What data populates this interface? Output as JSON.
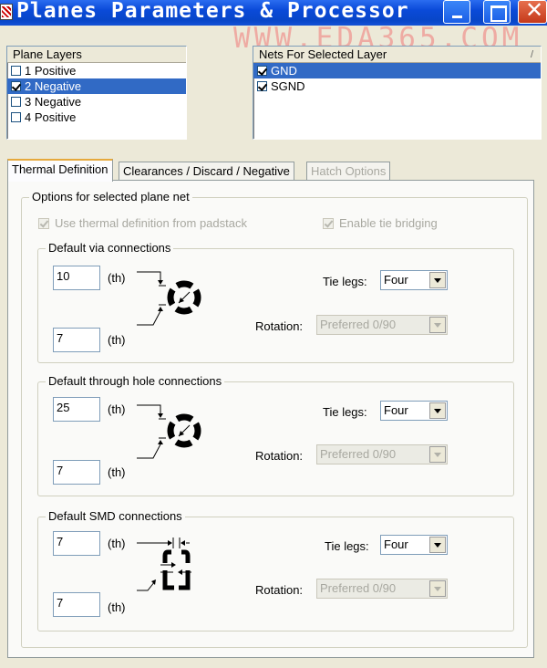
{
  "window": {
    "title": "Planes Parameters & Processor",
    "watermark": "WWW.EDA365.COM"
  },
  "plane_layers": {
    "header": "Plane Layers",
    "items": [
      {
        "label": "1 Positive",
        "checked": false,
        "selected": false
      },
      {
        "label": "2 Negative",
        "checked": true,
        "selected": true
      },
      {
        "label": "3 Negative",
        "checked": false,
        "selected": false
      },
      {
        "label": "4 Positive",
        "checked": false,
        "selected": false
      }
    ]
  },
  "nets": {
    "header": "Nets For Selected Layer",
    "items": [
      {
        "label": "GND",
        "checked": true,
        "selected": true
      },
      {
        "label": "SGND",
        "checked": true,
        "selected": false
      }
    ]
  },
  "tabs": [
    {
      "label": "Thermal Definition",
      "state": "active"
    },
    {
      "label": "Clearances / Discard / Negative",
      "state": "normal"
    },
    {
      "label": "Hatch Options",
      "state": "disabled"
    }
  ],
  "options_group": {
    "title": "Options for selected plane net",
    "use_thermal_label": "Use thermal definition from padstack",
    "enable_tie_label": "Enable tie bridging"
  },
  "units": "(th)",
  "tie_legs_label": "Tie legs:",
  "rotation_label": "Rotation:",
  "via": {
    "title": "Default via connections",
    "value1": "10",
    "value2": "7",
    "tie_legs": "Four",
    "rotation": "Preferred 0/90"
  },
  "through_hole": {
    "title": "Default through hole connections",
    "value1": "25",
    "value2": "7",
    "tie_legs": "Four",
    "rotation": "Preferred 0/90"
  },
  "smd": {
    "title": "Default SMD connections",
    "value1": "7",
    "value2": "7",
    "tie_legs": "Four",
    "rotation": "Preferred 0/90"
  }
}
